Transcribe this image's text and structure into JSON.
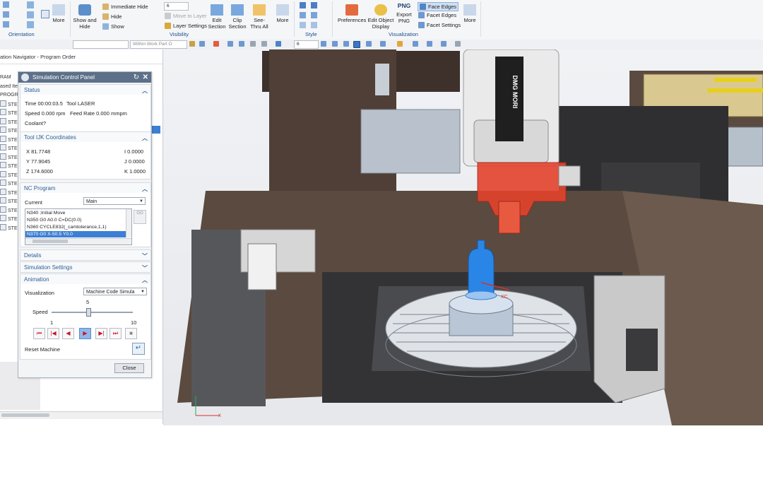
{
  "ribbon": {
    "groups": [
      "Orientation",
      "Visibility",
      "Style",
      "Visualization"
    ],
    "more_label": "More",
    "show_and_hide_label": "Show and Hide",
    "immediate_hide_label": "Immediate Hide",
    "hide_label": "Hide",
    "show_label": "Show",
    "layer_combo_value": "6",
    "move_to_layer_label": "Move to Layer",
    "layer_settings_label": "Layer Settings",
    "edit_section_label": "Edit Section",
    "clip_section_label": "Clip Section",
    "see_thru_all_label": "See-Thru All",
    "preferences_label": "Preferences",
    "edit_object_display_label": "Edit Object Display",
    "export_png_label": "Export PNG",
    "png_icon_text": "PNG",
    "face_edges_label": "Face Edges",
    "facet_edges_label": "Facet Edges",
    "facet_settings_label": "Facet Settings",
    "more2_label": "More"
  },
  "toolbar2": {
    "filter_combo": "Within Work Part O",
    "layer_combo": "6"
  },
  "navigator": {
    "title": "ation Navigator - Program Order",
    "rows": [
      "RAM",
      "ased Iter",
      "PROGRA",
      "STEP",
      "STEP",
      "STEP",
      "STEP",
      "STEP",
      "STEP",
      "STEP",
      "STEP",
      "STEP",
      "STEP",
      "STEP",
      "STEP",
      "STEP",
      "STEP",
      "STEP"
    ]
  },
  "panel": {
    "title": "Simulation Control Panel",
    "status": {
      "header": "Status",
      "time_label": "Time 00:00:03.5",
      "tool_label": "Tool LASER",
      "speed_label": "Speed 0.000 rpm",
      "feed_label": "Feed Rate 0.000 mmpm",
      "coolant_label": "Coolant?"
    },
    "coords": {
      "header": "Tool IJK Coordinates",
      "x": "X 81.7748",
      "y": "Y 77.9045",
      "z": "Z 174.6000",
      "i": "I 0.0000",
      "j": "J 0.0000",
      "k": "K 1.0000"
    },
    "nc": {
      "header": "NC Program",
      "current_label": "Current",
      "current_value": "Main",
      "lines": [
        "N340 ;Initial Move",
        "N350 G0 A0.0 C=DC(0.0)",
        "N360 CYCLE832(_camtolerance,1,1)",
        "N370 G0 X-50.5 Y0.0"
      ],
      "selected_index": 3,
      "go_label": "GO"
    },
    "details_header": "Details",
    "sim_settings_header": "Simulation Settings",
    "animation": {
      "header": "Animation",
      "visualization_label": "Visualization",
      "visualization_value": "Machine Code Simula",
      "speed_label": "Speed",
      "speed_value": "5",
      "speed_min": "1",
      "speed_max": "10",
      "speed_fraction": 0.45,
      "reset_label": "Reset Machine"
    },
    "close_label": "Close"
  },
  "viewport": {
    "spindle_brand": "DMG MORI",
    "axis_x_label": "XC",
    "triad_x_label": "X"
  },
  "colors": {
    "ribbon_bg": "#f5f6f8",
    "panel_title_bg": "#5c7089",
    "section_header_text": "#2d5f99",
    "selection_blue": "#3d7fd3",
    "machine_brown": "#4f3f36",
    "spindle_head_red": "#e4432c",
    "tool_part_blue": "#2a86e6",
    "yellow_rail": "#e7cf1f"
  }
}
